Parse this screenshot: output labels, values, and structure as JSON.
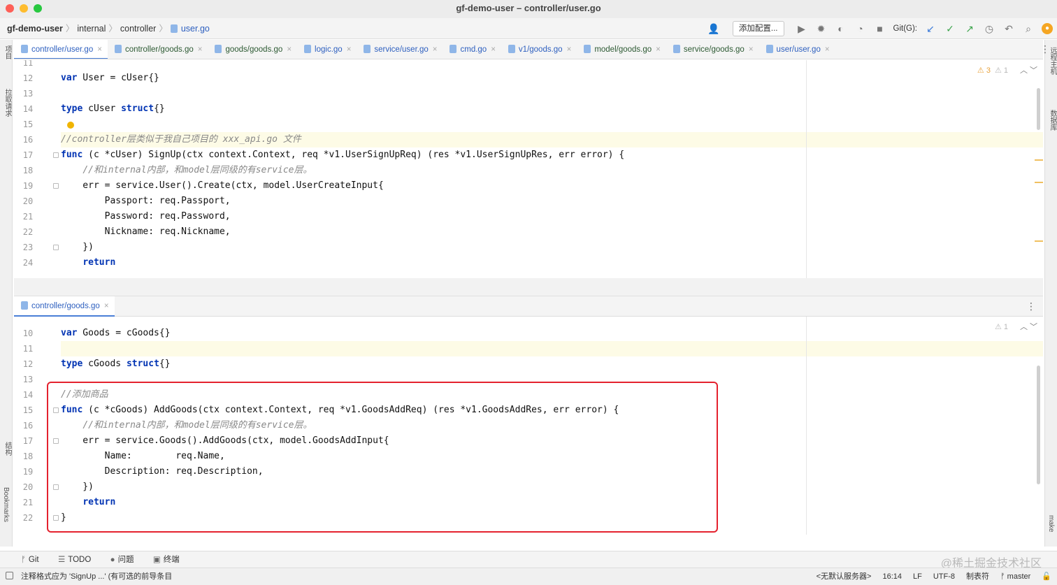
{
  "window": {
    "title": "gf-demo-user – controller/user.go"
  },
  "breadcrumb": {
    "project": "gf-demo-user",
    "dir1": "internal",
    "dir2": "controller",
    "file": "user.go"
  },
  "toolbar": {
    "add_config": "添加配置...",
    "git_label": "Git(G):"
  },
  "tabs": [
    {
      "label": "controller/user.go",
      "active": true
    },
    {
      "label": "controller/goods.go"
    },
    {
      "label": "goods/goods.go"
    },
    {
      "label": "logic.go"
    },
    {
      "label": "service/user.go"
    },
    {
      "label": "cmd.go"
    },
    {
      "label": "v1/goods.go"
    },
    {
      "label": "model/goods.go"
    },
    {
      "label": "service/goods.go"
    },
    {
      "label": "user/user.go"
    }
  ],
  "left_sidebar": {
    "project": "项目",
    "pull_requests": "拉取请求",
    "structure": "结构",
    "bookmarks": "Bookmarks"
  },
  "right_sidebar": {
    "remote": "远程主机",
    "database": "数据库",
    "make": "make"
  },
  "top_editor": {
    "warnings": "3",
    "weak_warnings": "1",
    "lines": [
      {
        "n": "11",
        "code": ""
      },
      {
        "n": "12",
        "code": "var User = cUser{}"
      },
      {
        "n": "13",
        "code": ""
      },
      {
        "n": "14",
        "code": "type cUser struct{}"
      },
      {
        "n": "15",
        "code": ""
      },
      {
        "n": "16",
        "code": "//controller层类似于我自己项目的 xxx_api.go 文件"
      },
      {
        "n": "17",
        "code": "func (c *cUser) SignUp(ctx context.Context, req *v1.UserSignUpReq) (res *v1.UserSignUpRes, err error) {"
      },
      {
        "n": "18",
        "code": "    //和internal内部，和model层同级的有service层。"
      },
      {
        "n": "19",
        "code": "    err = service.User().Create(ctx, model.UserCreateInput{"
      },
      {
        "n": "20",
        "code": "        Passport: req.Passport,"
      },
      {
        "n": "21",
        "code": "        Password: req.Password,"
      },
      {
        "n": "22",
        "code": "        Nickname: req.Nickname,"
      },
      {
        "n": "23",
        "code": "    })"
      },
      {
        "n": "24",
        "code": "    return"
      }
    ]
  },
  "split_tab": {
    "label": "controller/goods.go"
  },
  "bottom_editor": {
    "weak_warnings": "1",
    "lines": [
      {
        "n": "10",
        "code": "var Goods = cGoods{}"
      },
      {
        "n": "11",
        "code": ""
      },
      {
        "n": "12",
        "code": "type cGoods struct{}"
      },
      {
        "n": "13",
        "code": ""
      },
      {
        "n": "14",
        "code": "//添加商品"
      },
      {
        "n": "15",
        "code": "func (c *cGoods) AddGoods(ctx context.Context, req *v1.GoodsAddReq) (res *v1.GoodsAddRes, err error) {"
      },
      {
        "n": "16",
        "code": "    //和internal内部，和model层同级的有service层。"
      },
      {
        "n": "17",
        "code": "    err = service.Goods().AddGoods(ctx, model.GoodsAddInput{"
      },
      {
        "n": "18",
        "code": "        Name:        req.Name,"
      },
      {
        "n": "19",
        "code": "        Description: req.Description,"
      },
      {
        "n": "20",
        "code": "    })"
      },
      {
        "n": "21",
        "code": "    return"
      },
      {
        "n": "22",
        "code": "}"
      }
    ]
  },
  "tool_windows": {
    "git": "Git",
    "todo": "TODO",
    "problems": "问题",
    "terminal": "终端"
  },
  "status": {
    "message": "注释格式应为 'SignUp ...' (有可选的前导条目",
    "server": "<无默认服务器>",
    "position": "16:14",
    "line_sep": "LF",
    "encoding": "UTF-8",
    "indent": "制表符",
    "branch": "master"
  },
  "watermark": "@稀土掘金技术社区"
}
